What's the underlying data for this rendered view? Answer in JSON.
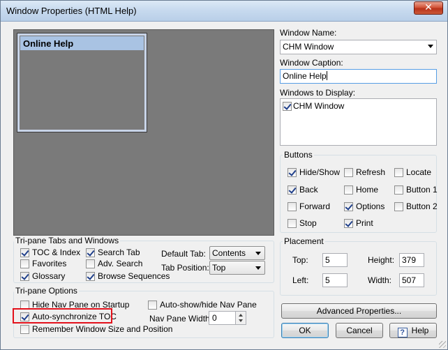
{
  "window": {
    "title": "Window Properties (HTML Help)",
    "close_label": "✕"
  },
  "preview": {
    "caption": "Online Help"
  },
  "window_name": {
    "label": "Window Name:",
    "value": "CHM Window"
  },
  "window_caption": {
    "label": "Window Caption:",
    "value": "Online Help"
  },
  "windows_to_display": {
    "label": "Windows to Display:",
    "items": [
      {
        "label": "CHM Window",
        "checked": true
      }
    ]
  },
  "buttons_group": {
    "title": "Buttons",
    "items": [
      {
        "label": "Hide/Show",
        "checked": true
      },
      {
        "label": "Refresh",
        "checked": false
      },
      {
        "label": "Locate",
        "checked": false
      },
      {
        "label": "Back",
        "checked": true
      },
      {
        "label": "Home",
        "checked": false
      },
      {
        "label": "Button 1",
        "checked": false
      },
      {
        "label": "Forward",
        "checked": false
      },
      {
        "label": "Options",
        "checked": true
      },
      {
        "label": "Button 2",
        "checked": false
      },
      {
        "label": "Stop",
        "checked": false
      },
      {
        "label": "Print",
        "checked": true
      }
    ]
  },
  "placement": {
    "title": "Placement",
    "top_label": "Top:",
    "top_value": "5",
    "height_label": "Height:",
    "height_value": "379",
    "left_label": "Left:",
    "left_value": "5",
    "width_label": "Width:",
    "width_value": "507"
  },
  "tabs_group": {
    "title": "Tri-pane Tabs and Windows",
    "toc_index": {
      "label": "TOC & Index",
      "checked": true
    },
    "favorites": {
      "label": "Favorites",
      "checked": false
    },
    "glossary": {
      "label": "Glossary",
      "checked": true
    },
    "search_tab": {
      "label": "Search Tab",
      "checked": true
    },
    "adv_search": {
      "label": "Adv. Search",
      "checked": false
    },
    "browse_sequences": {
      "label": "Browse Sequences",
      "checked": true
    },
    "default_tab_label": "Default Tab:",
    "default_tab_value": "Contents",
    "tab_position_label": "Tab Position:",
    "tab_position_value": "Top"
  },
  "options_group": {
    "title": "Tri-pane Options",
    "hide_nav": {
      "label": "Hide Nav Pane on Startup",
      "checked": false
    },
    "auto_sync": {
      "label": "Auto-synchronize TOC",
      "checked": true
    },
    "remember": {
      "label": "Remember Window Size and Position",
      "checked": false
    },
    "auto_show": {
      "label": "Auto-show/hide Nav Pane",
      "checked": false
    },
    "nav_width_label": "Nav Pane Width:",
    "nav_width_value": "0"
  },
  "actions": {
    "advanced": "Advanced Properties...",
    "ok": "OK",
    "cancel": "Cancel",
    "help": "Help",
    "help_icon": "?"
  },
  "colors": {
    "highlight_box": "#e3111b",
    "preview_bg": "#7a7a7a",
    "preview_title_bg": "#a9c3e3"
  }
}
